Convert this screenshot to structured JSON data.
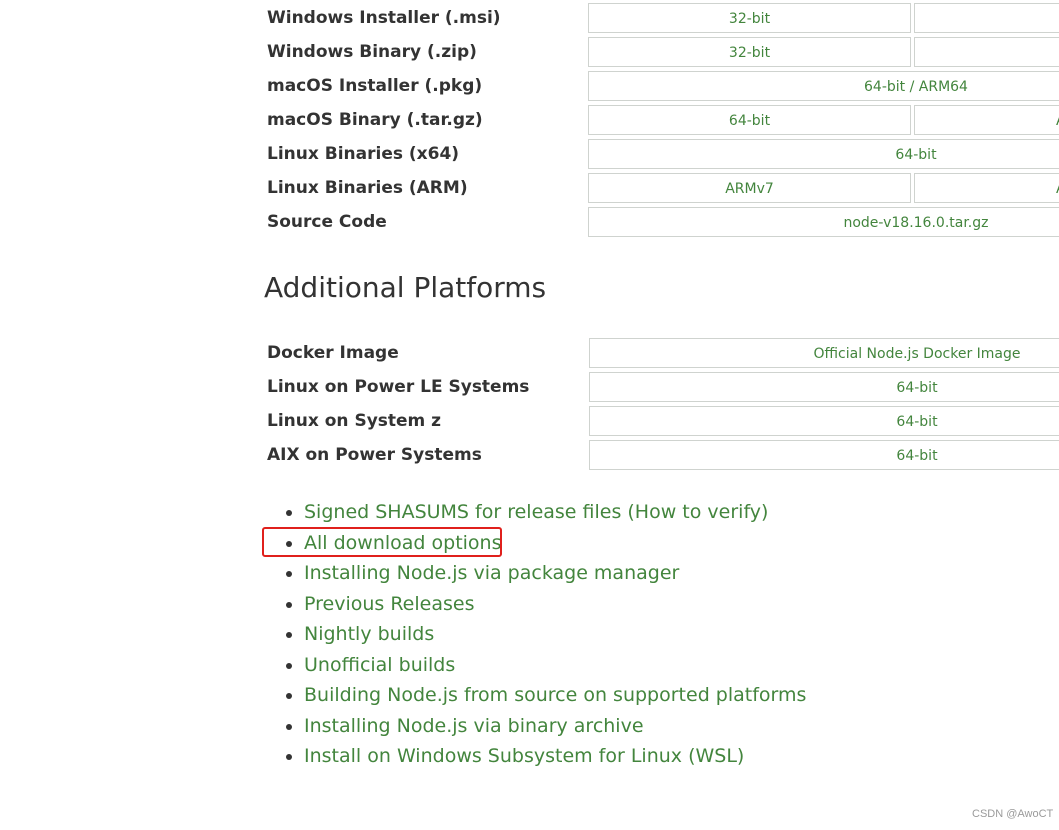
{
  "downloads_table": {
    "rows": [
      {
        "label": "Windows Installer (.msi)",
        "cell_a": "32-bit"
      },
      {
        "label": "Windows Binary (.zip)",
        "cell_a": "32-bit"
      },
      {
        "label": "macOS Installer (.pkg)",
        "cell_full": "64-bit / ARM64"
      },
      {
        "label": "macOS Binary (.tar.gz)",
        "cell_a": "64-bit",
        "cell_b_partial": "A"
      },
      {
        "label": "Linux Binaries (x64)",
        "cell_full": "64-bit"
      },
      {
        "label": "Linux Binaries (ARM)",
        "cell_a": "ARMv7",
        "cell_b_partial": "A"
      },
      {
        "label": "Source Code",
        "cell_full": "node-v18.16.0.tar.gz"
      }
    ]
  },
  "additional_platforms": {
    "title": "Additional Platforms",
    "rows": [
      {
        "label": "Docker Image",
        "cell_full": "Official Node.js Docker Image"
      },
      {
        "label": "Linux on Power LE Systems",
        "cell_full": "64-bit"
      },
      {
        "label": "Linux on System z",
        "cell_full": "64-bit"
      },
      {
        "label": "AIX on Power Systems",
        "cell_full": "64-bit"
      }
    ]
  },
  "links": [
    "Signed SHASUMS for release files (How to verify)",
    "All download options",
    "Installing Node.js via package manager",
    "Previous Releases",
    "Nightly builds",
    "Unofficial builds",
    "Building Node.js from source on supported platforms",
    "Installing Node.js via binary archive",
    "Install on Windows Subsystem for Linux (WSL)"
  ],
  "highlighted_link": "All download options",
  "watermark": "CSDN @AwoCT",
  "colors": {
    "link": "#43853d",
    "text": "#333333",
    "cell_border": "#cfd3cf",
    "highlight": "#e0201c"
  }
}
